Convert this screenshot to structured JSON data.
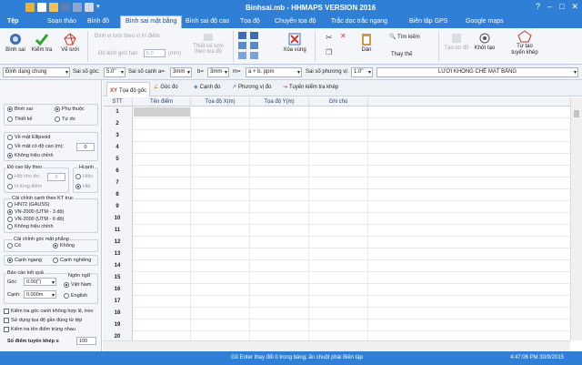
{
  "app": {
    "title": "Binhsai.mb - HHMAPS VERSION 2016"
  },
  "ribbon_tabs": [
    "Tệp",
    "Soạn thảo",
    "Bình đồ",
    "Bình sai mặt bằng",
    "Bình sai độ cao",
    "Tọa độ",
    "Chuyển tọa độ",
    "Trắc dọc trắc ngang",
    "Biên tập GPS",
    "Google maps"
  ],
  "ribbon": {
    "binh_sai": "Bình sai",
    "kiem_tra": "Kiểm tra",
    "ve_luoi": "Vẽ lưới",
    "dinh_vi_1": "Định vị lưới theo vị trí điểm",
    "do_lech_gioi_han": "Độ lệch giới hạn",
    "do_lech_value": "5.0",
    "do_lech_unit": "(mm)",
    "thiet_ke": "Thiết kế lưới theo tọa độ",
    "xoa_vung": "Xóa vùng",
    "dan": "Dán",
    "tim_kiem": "Tìm kiếm",
    "thay_the": "Thay thế",
    "tao_so_do": "Tạo sơ đồ",
    "khoi_tao": "Khởi tạo",
    "tu_tao": "Tự tạo tuyến khép"
  },
  "params": {
    "dinh_dang": "Định dạng chung",
    "ss_goc_label": "Sai số góc:",
    "ss_goc": "5.0\"",
    "ss_canh_a_label": "Sai số cạnh a=",
    "ss_canh_a": "3mm",
    "b_label": "b=",
    "b_value": "3mm",
    "m_label": "m=",
    "m_value": "a + b. ppm",
    "ss_pv_label": "Sai số phương vị:",
    "ss_pv": "1.0\"",
    "loai_luoi": "LƯỚI KHỐNG CHẾ MẶT BẰNG"
  },
  "left_panel": {
    "binh_sai": "Bình sai",
    "phu_thuoc": "Phụ thuộc",
    "thiet_ke": "Thiết kế",
    "tu_do": "Tự do",
    "ve_mat_ellipsoid": "Về mặt Ellipsoid",
    "ve_mat_co_do_cao": "Về mặt có độ cao (m):",
    "do_cao_value": "0",
    "khong_hieu_chinh": "Không hiệu chỉnh",
    "do_cao_lay_theo": "Độ cao lấy theo",
    "htb_khu_do": "Htb khu đo:",
    "htb_value": "0",
    "h_tung_diem": "H từng điểm",
    "h_canh": "Hcạnh",
    "hieu": "Hiệu",
    "htb": "Htb",
    "cai_chinh_canh": "Cải chỉnh cạnh theo KT trục",
    "hn72": "HN72 (GAUSS)",
    "vn2000_3": "VN-2000 (UTM - 3 độ)",
    "vn2000_6": "VN-2000 (UTM - 6 độ)",
    "khong_hieu_chinh2": "Không hiệu chỉnh",
    "cai_chinh_goc": "Cải chỉnh góc mặt phẳng",
    "co": "Có",
    "khong": "Không",
    "canh_ngang": "Cạnh ngang",
    "canh_nghieng": "Cạnh nghiêng",
    "bao_cao": "Báo cáo kết quả",
    "goc_label": "Góc",
    "goc_value": "0.00(\")",
    "canh_label": "Cạnh:",
    "canh_value": "0.000m",
    "ngon_ngu": "Ngôn ngữ",
    "viet_nam": "Việt Nam",
    "english": "English",
    "chk1": "Kiểm tra góc canh không hợp lệ, treo",
    "chk2": "Sử dụng tọa độ gần đúng từ tệp",
    "chk3": "Kiểm tra tên điểm trùng nhau",
    "so_diem_label": "Số điểm tuyến khép ≤",
    "so_diem_value": "100"
  },
  "subtabs": [
    "Tọa độ gốc",
    "Góc đo",
    "Cạnh đo",
    "Phương vị đo",
    "Tuyến kiểm tra khép"
  ],
  "table": {
    "headers": [
      "STT",
      "Tên điểm",
      "Tọa độ X(m)",
      "Tọa độ Y(m)",
      "Ghi chú"
    ],
    "rows": [
      "1",
      "2",
      "3",
      "4",
      "5",
      "6",
      "7",
      "8",
      "9",
      "10",
      "11",
      "12",
      "13",
      "14",
      "15",
      "16",
      "17",
      "18",
      "19",
      "20"
    ]
  },
  "status": {
    "message": "Gõ Enter thay đổi ô trong bảng; ấn chuột phải Biên tập",
    "datetime": "4:47:06 PM 30/9/2015"
  },
  "colors": {
    "accent": "#2f7fd6",
    "ribbon_bg": "#f4f6f9"
  }
}
